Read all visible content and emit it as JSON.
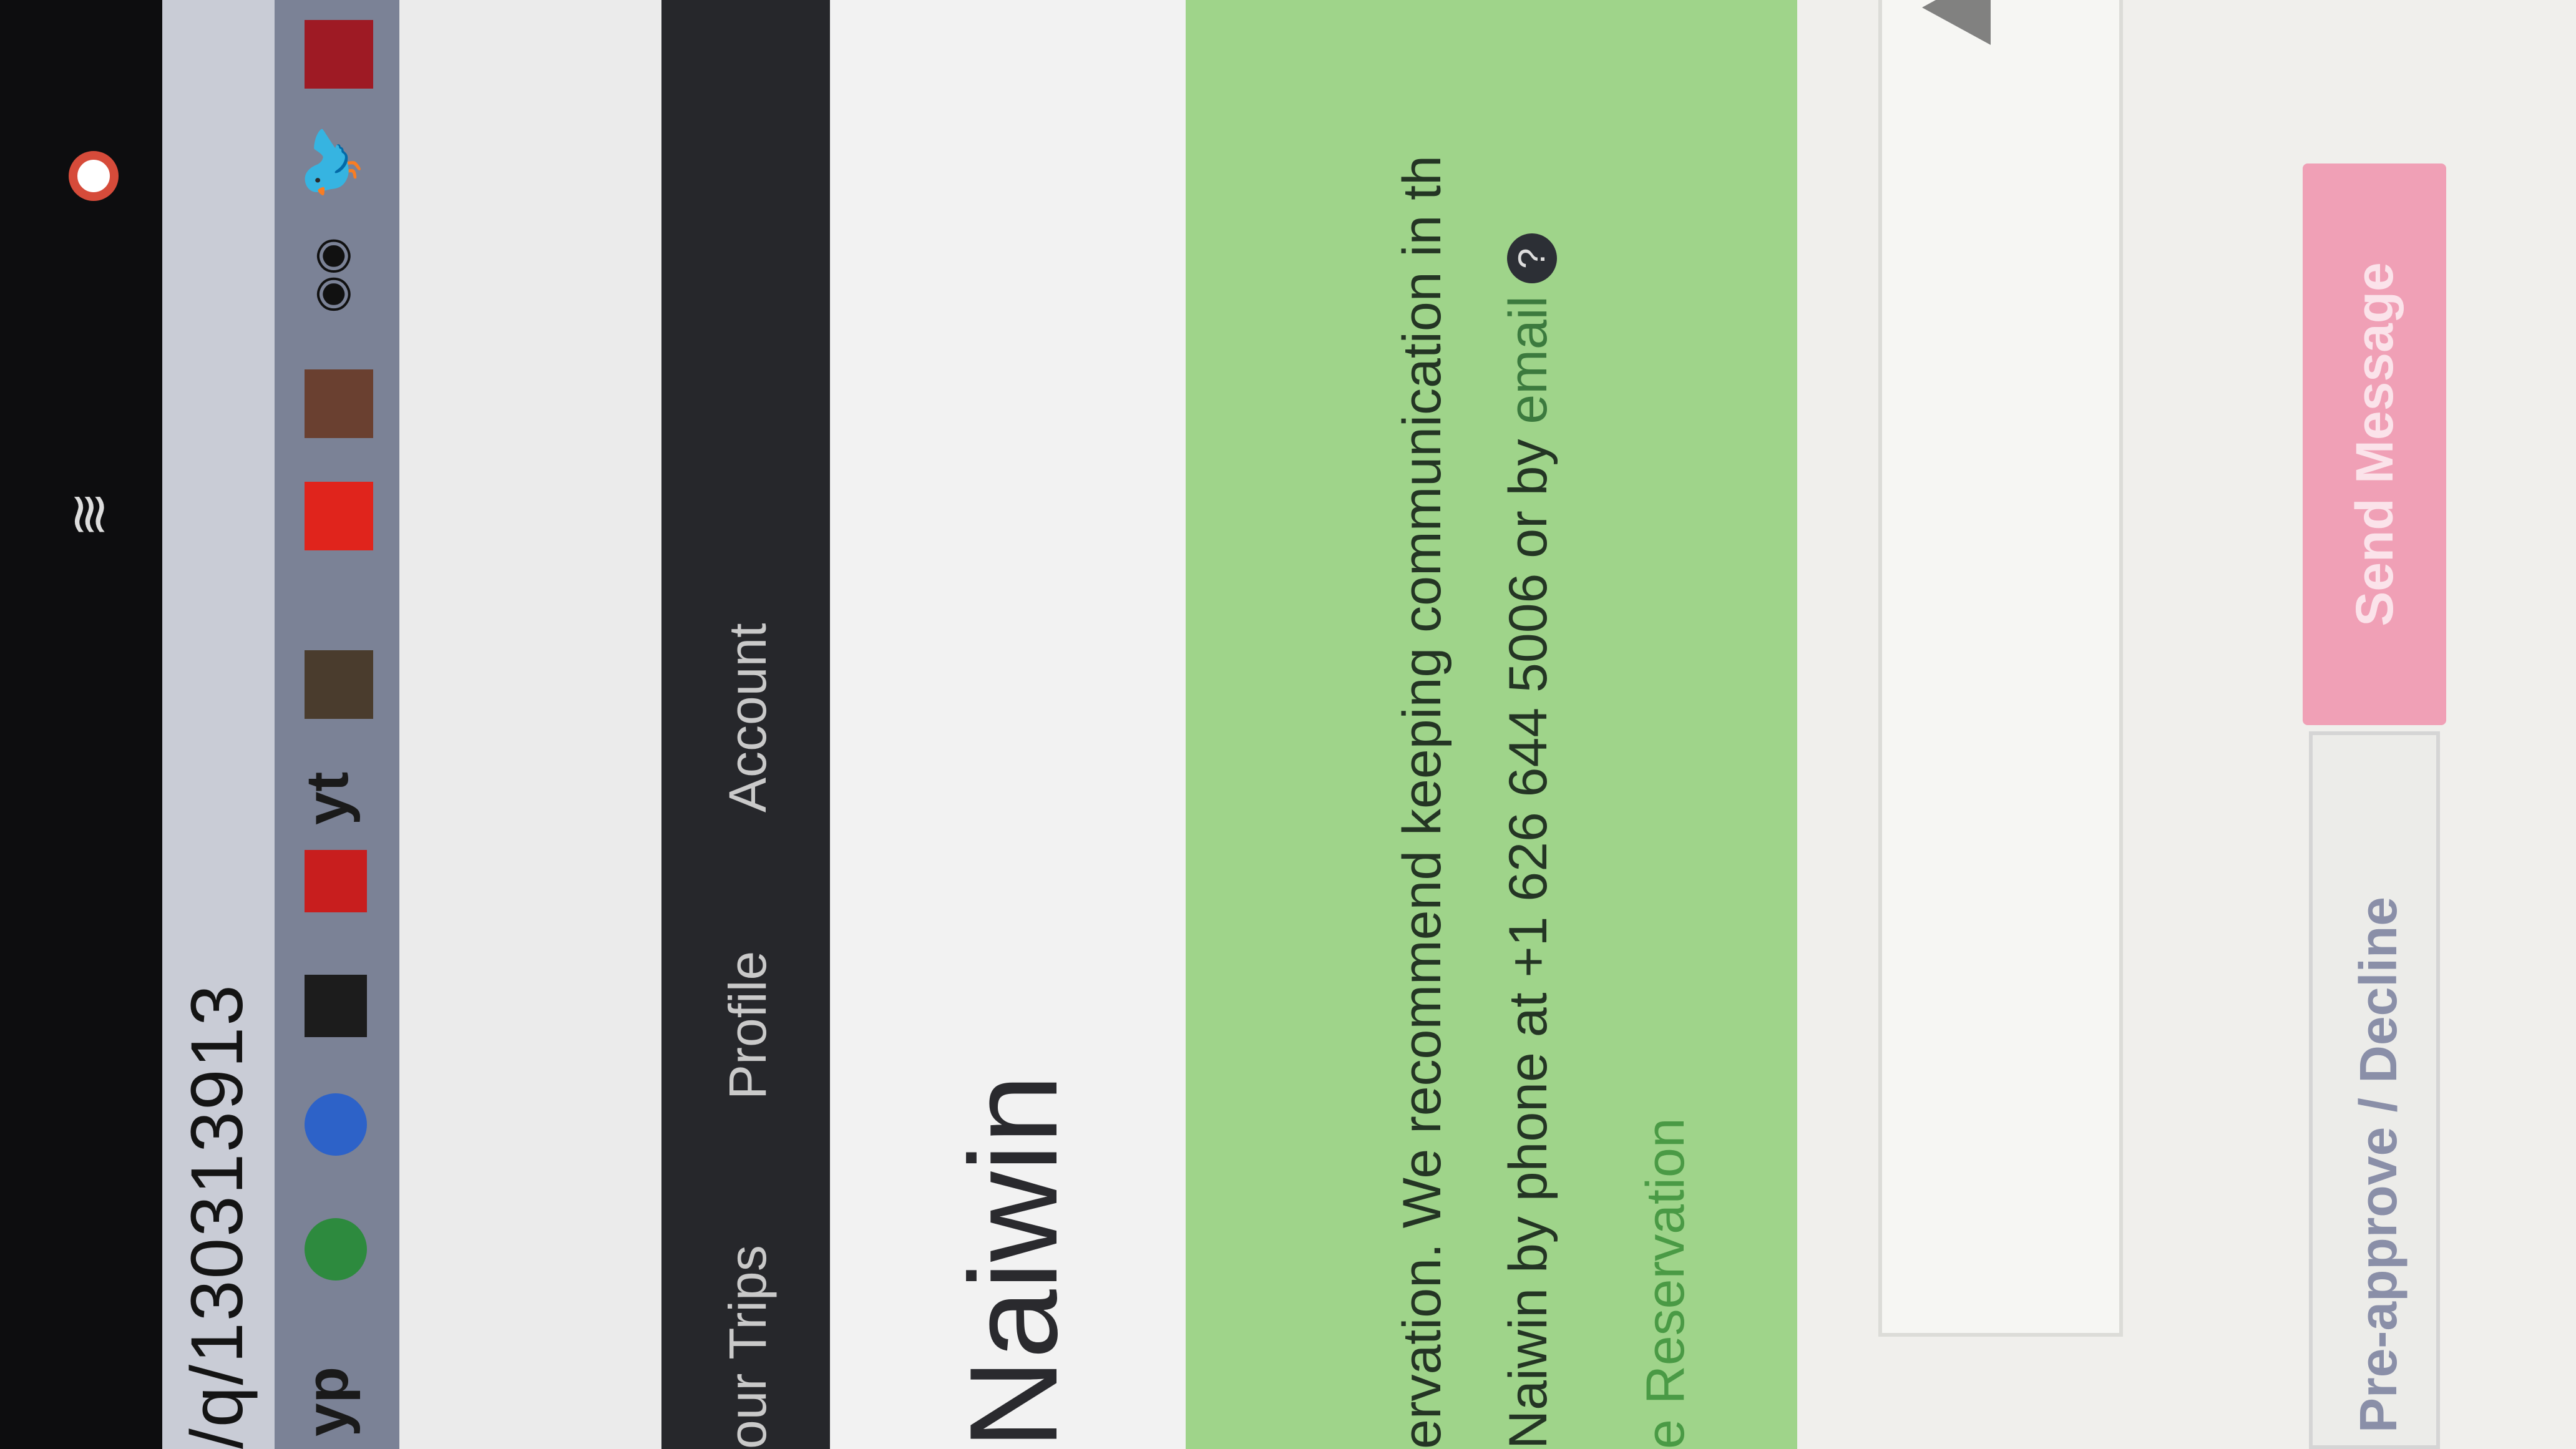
{
  "browser": {
    "url_text": "/q/130313913"
  },
  "bookmarks": {
    "yp_label": "yp",
    "yt_label": "yt"
  },
  "nav": {
    "your_trips": "our Trips",
    "profile": "Profile",
    "account": "Account"
  },
  "page": {
    "host_name": "Naiwin"
  },
  "notice": {
    "line1": "ervation. We recommend keeping communication in th",
    "line2_prefix": "Naiwin by phone at +1 626 644 5006 or by ",
    "email_link": "email",
    "line3": "e Reservation"
  },
  "actions": {
    "decline_label": "Pre-approve / Decline",
    "send_label": "Send Message"
  },
  "colors": {
    "notice_bg": "#9fd48a",
    "send_button_bg": "#f0a0b6",
    "nav_bg": "#26272b"
  }
}
